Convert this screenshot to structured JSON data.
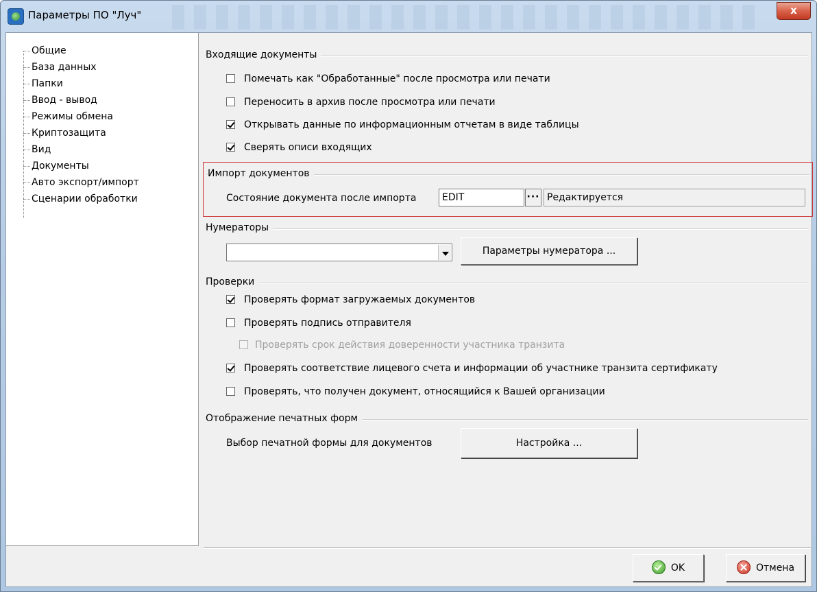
{
  "window": {
    "title": "Параметры ПО \"Луч\"",
    "close_glyph": "x",
    "app_icon": "globe-app-icon"
  },
  "tree": {
    "items": [
      {
        "label": "Общие"
      },
      {
        "label": "База данных"
      },
      {
        "label": "Папки"
      },
      {
        "label": "Ввод - вывод"
      },
      {
        "label": "Режимы обмена"
      },
      {
        "label": "Криптозащита"
      },
      {
        "label": "Вид"
      },
      {
        "label": "Документы"
      },
      {
        "label": "Авто экспорт/импорт"
      },
      {
        "label": "Сценарии обработки"
      }
    ]
  },
  "incoming": {
    "title": "Входящие документы",
    "options": [
      {
        "label": "Помечать как \"Обработанные\" после просмотра или печати",
        "checked": false
      },
      {
        "label": "Переносить в архив после просмотра или печати",
        "checked": false
      },
      {
        "label": "Открывать данные по информационным отчетам в виде таблицы",
        "checked": true
      },
      {
        "label": "Сверять описи входящих",
        "checked": true
      }
    ]
  },
  "import": {
    "title": "Импорт документов",
    "state_label": "Состояние документа после импорта",
    "state_code": "EDIT",
    "browse_label": "···",
    "state_name": "Редактируется",
    "highlight_color": "#cc3333"
  },
  "numerators": {
    "title": "Нумераторы",
    "selected": "",
    "params_button": "Параметры нумератора ..."
  },
  "checks": {
    "title": "Проверки",
    "options": [
      {
        "label": "Проверять формат загружаемых документов",
        "checked": true,
        "enabled": true
      },
      {
        "label": "Проверять подпись отправителя",
        "checked": false,
        "enabled": true
      },
      {
        "label": "Проверять срок действия доверенности участника транзита",
        "checked": false,
        "enabled": false
      },
      {
        "label": "Проверять соответствие лицевого счета и информации об участнике транзита сертификату",
        "checked": true,
        "enabled": true
      },
      {
        "label": "Проверять, что получен документ, относящийся к Вашей организации",
        "checked": false,
        "enabled": true
      }
    ]
  },
  "print_forms": {
    "title": "Отображение печатных форм",
    "select_label": "Выбор печатной формы для документов",
    "settings_button": "Настройка ..."
  },
  "footer": {
    "ok_label": "OK",
    "cancel_label": "Отмена"
  }
}
